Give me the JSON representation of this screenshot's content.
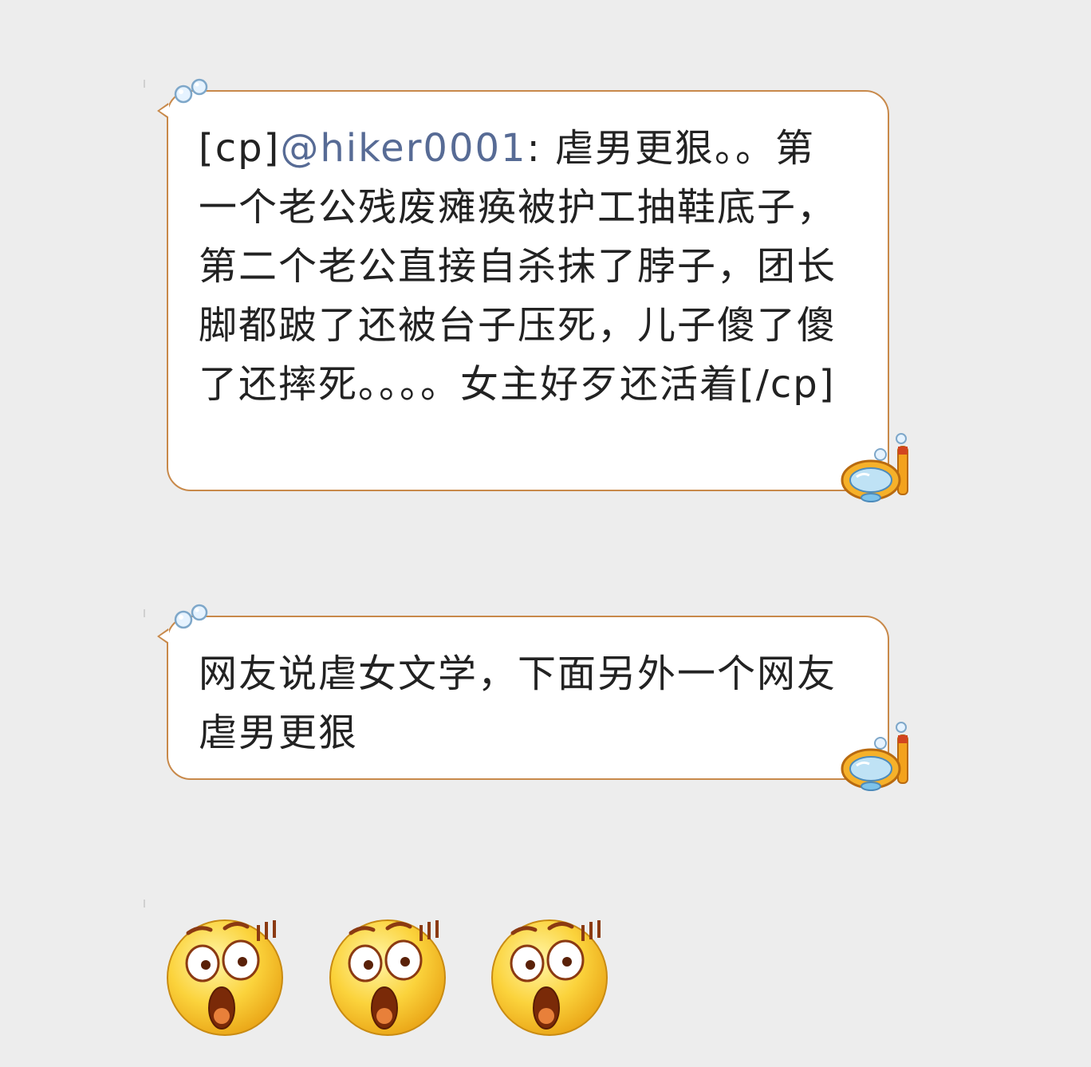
{
  "messages": [
    {
      "prefix": "[cp]",
      "mention": "@hiker0001",
      "text": ": 虐男更狠。。第一个老公残废瘫痪被护工抽鞋底子，第二个老公直接自杀抹了脖子，团长脚都跛了还被台子压死，儿子傻了傻了还摔死。。。。女主好歹还活着[/cp]"
    },
    {
      "text": "网友说虐女文学，下面另外一个网友虐男更狠"
    }
  ],
  "emoji_row": {
    "icons": [
      "shocked-face-emoji",
      "shocked-face-emoji",
      "shocked-face-emoji"
    ]
  },
  "colors": {
    "background": "#ededed",
    "bubble_border": "#c8894a",
    "bubble_fill": "#ffffff",
    "mention": "#576b95",
    "text": "#222222"
  }
}
